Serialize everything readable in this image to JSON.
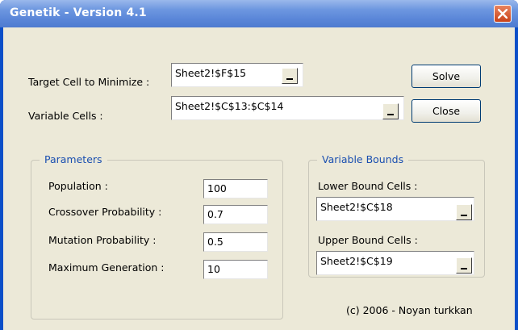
{
  "window": {
    "title": "Genetik - Version 4.1"
  },
  "main": {
    "target_label": "Target Cell to Minimize :",
    "target_value": "Sheet2!$F$15",
    "variable_label": "Variable Cells :",
    "variable_value": "Sheet2!$C$13:$C$14",
    "solve_label": "Solve",
    "close_label": "Close"
  },
  "parameters": {
    "legend": "Parameters",
    "items": [
      {
        "label": "Population :",
        "value": "100"
      },
      {
        "label": "Crossover Probability :",
        "value": "0.7"
      },
      {
        "label": "Mutation Probability :",
        "value": "0.5"
      },
      {
        "label": "Maximum Generation :",
        "value": "10"
      }
    ]
  },
  "bounds": {
    "legend": "Variable Bounds",
    "lower_label": "Lower Bound Cells :",
    "lower_value": "Sheet2!$C$18",
    "upper_label": "Upper Bound Cells :",
    "upper_value": "Sheet2!$C$19"
  },
  "footer": {
    "copyright": "(c) 2006 - Noyan turkkan"
  },
  "colors": {
    "titlebar": "#6d97e0",
    "client": "#ece9d8",
    "legend_text": "#1a4fb0",
    "close_button": "#c8421a"
  }
}
